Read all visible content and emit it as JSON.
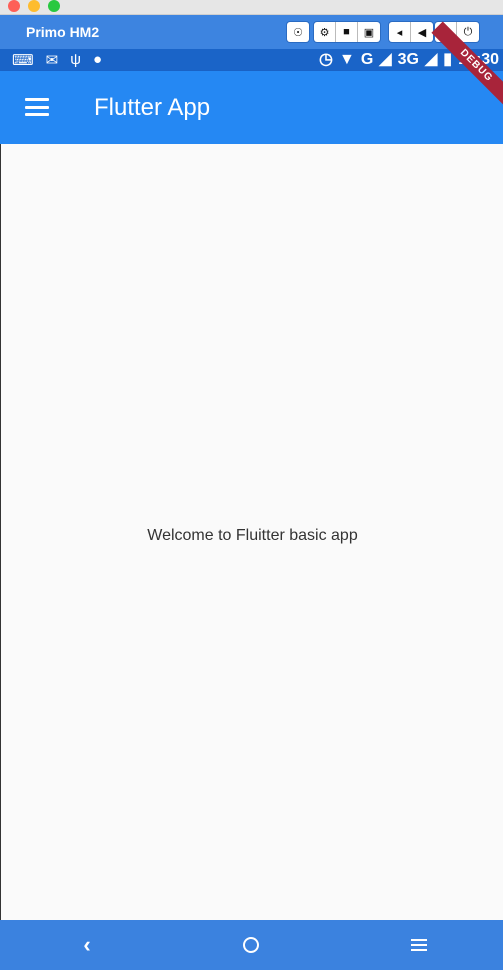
{
  "window": {
    "title": "Primo HM2"
  },
  "emulator_toolbar": {
    "groups": [
      [
        "headset-icon"
      ],
      [
        "settings-icon",
        "video-icon",
        "camera-icon"
      ],
      [
        "volume-down-icon",
        "volume-up-icon"
      ],
      [
        "rotate-icon",
        "power-icon"
      ]
    ]
  },
  "status_bar": {
    "network_g": "G",
    "network_3g": "3G",
    "time": "12:30"
  },
  "app_bar": {
    "title": "Flutter App"
  },
  "debug_banner": "DEBUG",
  "body": {
    "message": "Welcome to Fluitter basic app"
  },
  "colors": {
    "emulator_bar": "#3d84e0",
    "status_bar": "#1a64c8",
    "app_bar": "#2588f3",
    "nav_bar": "#3b82df",
    "background": "#fafafa",
    "debug_ribbon": "#a8243a"
  }
}
